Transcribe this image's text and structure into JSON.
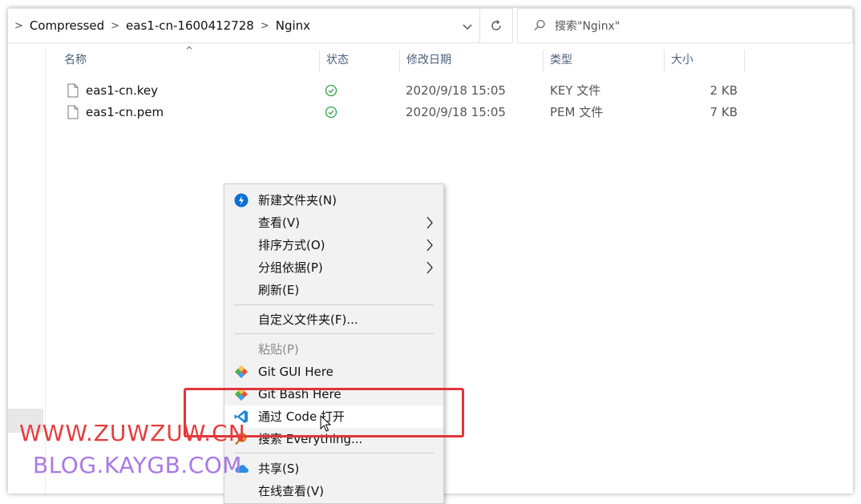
{
  "breadcrumb": {
    "items": [
      "Compressed",
      "eas1-cn-1600412728",
      "Nginx"
    ]
  },
  "search": {
    "placeholder": "搜索\"Nginx\""
  },
  "columns": {
    "name": "名称",
    "status": "状态",
    "modified": "修改日期",
    "type": "类型",
    "size": "大小"
  },
  "files": [
    {
      "name": "eas1-cn.key",
      "modified": "2020/9/18 15:05",
      "type": "KEY 文件",
      "size": "2 KB"
    },
    {
      "name": "eas1-cn.pem",
      "modified": "2020/9/18 15:05",
      "type": "PEM 文件",
      "size": "7 KB"
    }
  ],
  "context_menu": {
    "items": [
      {
        "label": "新建文件夹(N)",
        "icon": "new-folder-icon"
      },
      {
        "label": "查看(V)",
        "submenu": true
      },
      {
        "label": "排序方式(O)",
        "submenu": true
      },
      {
        "label": "分组依据(P)",
        "submenu": true
      },
      {
        "label": "刷新(E)"
      },
      {
        "label": "自定义文件夹(F)..."
      },
      {
        "label": "粘贴(P)",
        "disabled": true
      },
      {
        "label": "Git GUI Here",
        "icon": "git-icon"
      },
      {
        "label": "Git Bash Here",
        "icon": "git-icon"
      },
      {
        "label": "通过 Code 打开",
        "icon": "vscode-icon"
      },
      {
        "label": "搜索 Everything...",
        "icon": "everything-search-icon"
      },
      {
        "label": "共享(S)",
        "icon": "onedrive-icon"
      },
      {
        "label": "在线查看(V)"
      }
    ]
  },
  "watermarks": {
    "line1": "WWW.ZUWZUW.CN",
    "line2": "BLOG.KAYGB.COM"
  },
  "colors": {
    "accent_blue": "#0a6fd6",
    "status_green": "#2ea043",
    "highlight_red": "#e0353a",
    "watermark_red": "#e83c3c",
    "watermark_purple": "#a979e4"
  }
}
